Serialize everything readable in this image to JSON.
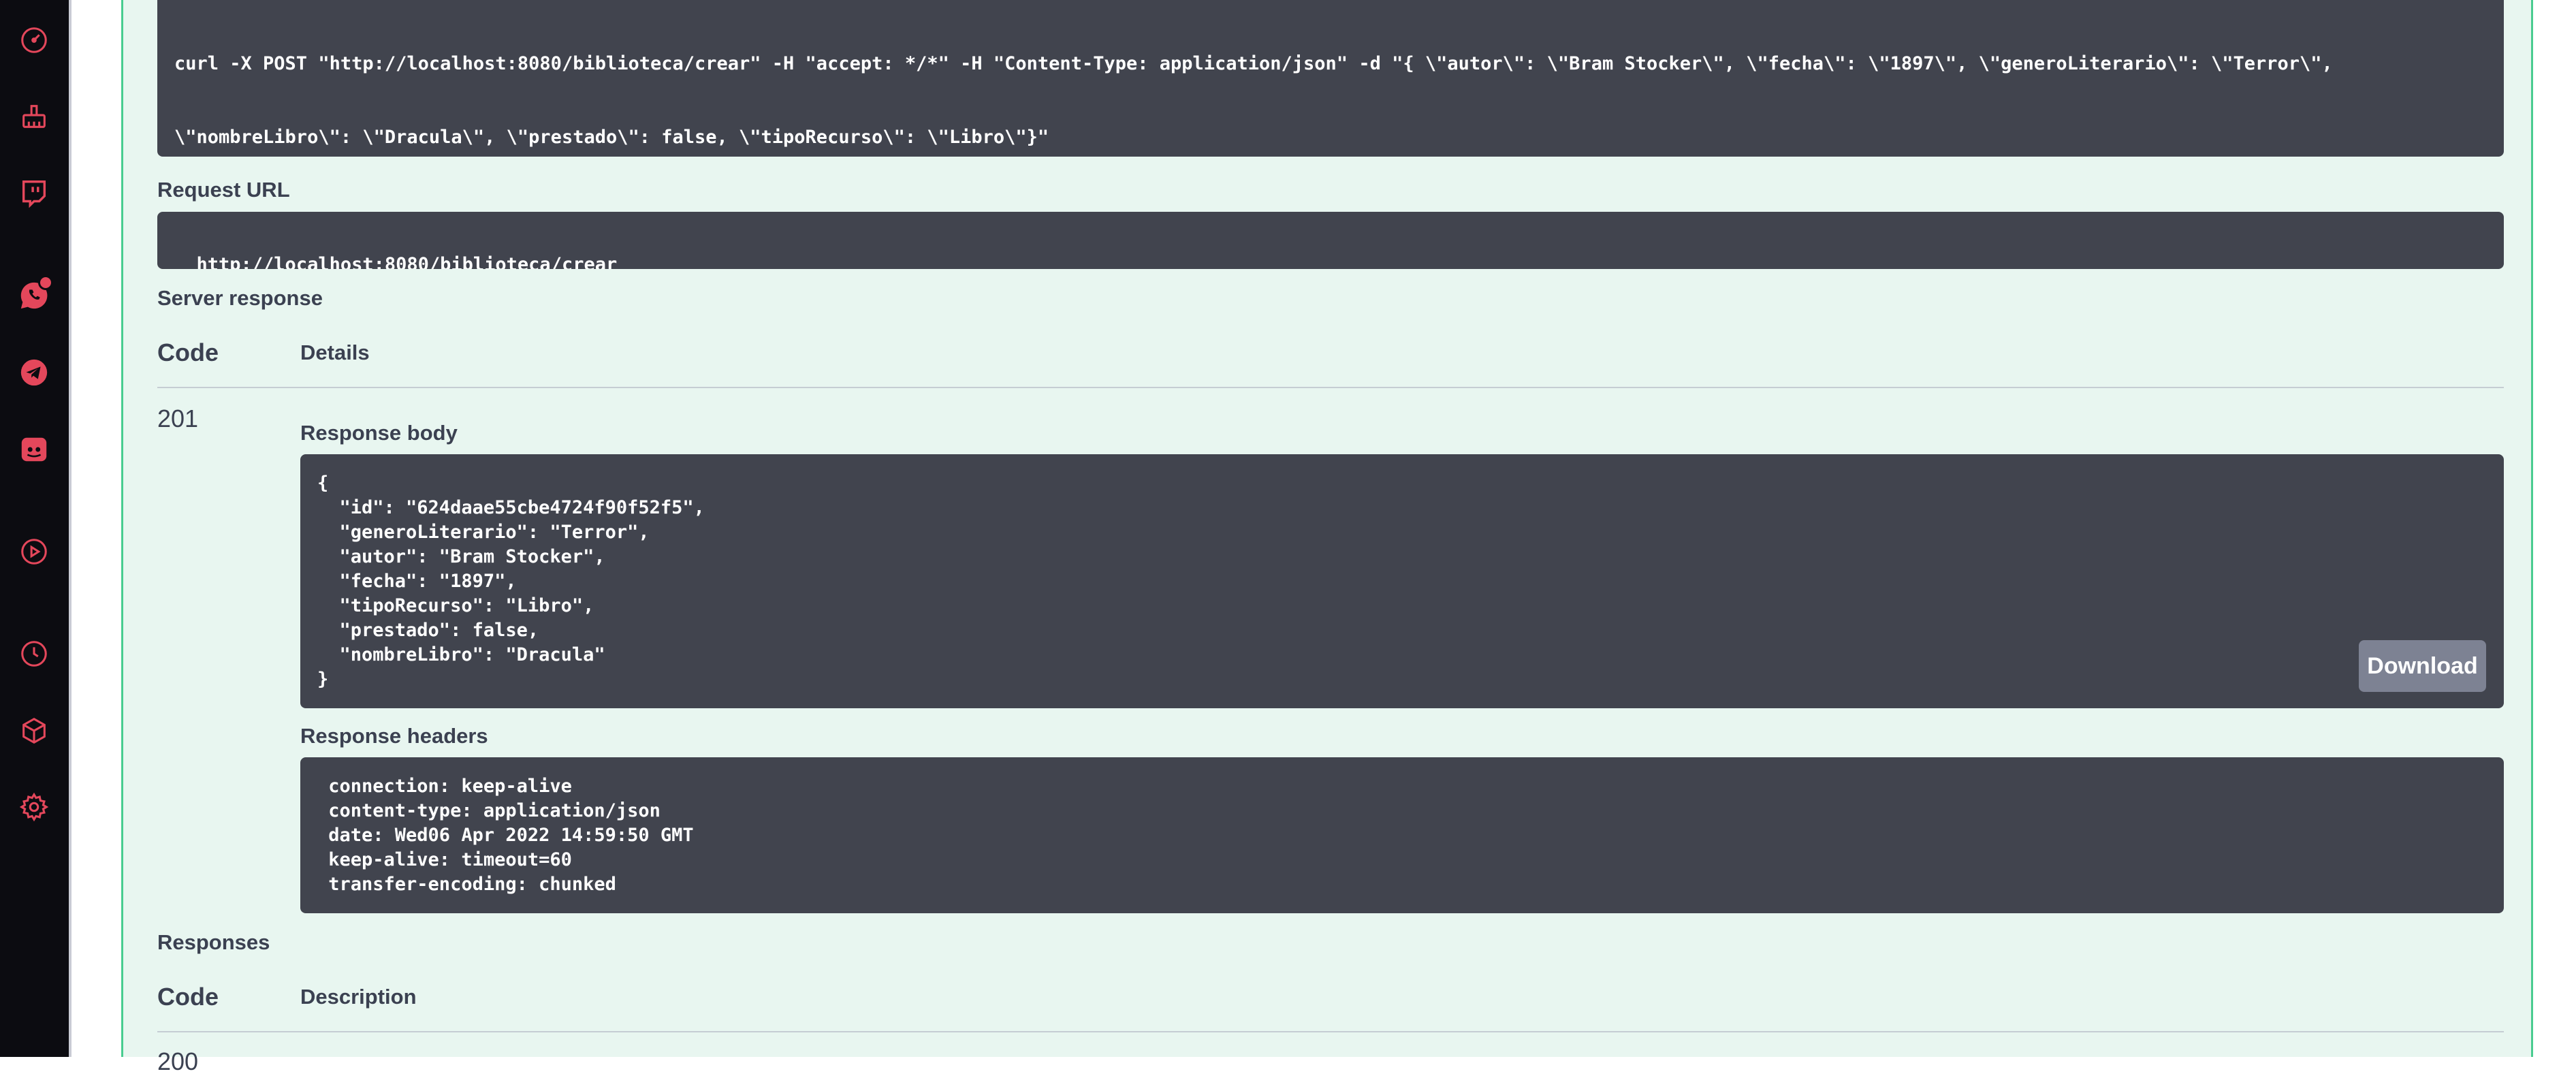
{
  "sidebar": {
    "icons": [
      {
        "name": "dashboard-gauge-icon"
      },
      {
        "name": "cleaning-brush-icon"
      },
      {
        "name": "twitch-icon"
      },
      {
        "name": "whatsapp-icon",
        "notification": true
      },
      {
        "name": "telegram-icon"
      },
      {
        "name": "discord-icon"
      },
      {
        "name": "play-circle-icon"
      },
      {
        "name": "history-clock-icon"
      },
      {
        "name": "cube-icon"
      },
      {
        "name": "settings-gear-icon"
      }
    ]
  },
  "curl": {
    "command_line1": "curl -X POST \"http://localhost:8080/biblioteca/crear\" -H \"accept: */*\" -H \"Content-Type: application/json\" -d \"{ \\\"autor\\\": \\\"Bram Stocker\\\", \\\"fecha\\\": \\\"1897\\\", \\\"generoLiterario\\\": \\\"Terror\\\",",
    "command_line2": "\\\"nombreLibro\\\": \\\"Dracula\\\", \\\"prestado\\\": false, \\\"tipoRecurso\\\": \\\"Libro\\\"}\""
  },
  "request_url": {
    "label": "Request URL",
    "value": "http://localhost:8080/biblioteca/crear"
  },
  "server_response": {
    "label": "Server response",
    "col_code": "Code",
    "col_details": "Details",
    "code": "201",
    "response_body_label": "Response body",
    "response_body_lines": [
      "{",
      "  \"id\": \"624daae55cbe4724f90f52f5\",",
      "  \"generoLiterario\": \"Terror\",",
      "  \"autor\": \"Bram Stocker\",",
      "  \"fecha\": \"1897\",",
      "  \"tipoRecurso\": \"Libro\",",
      "  \"prestado\": false,",
      "  \"nombreLibro\": \"Dracula\"",
      "}"
    ],
    "download_label": "Download",
    "response_headers_label": "Response headers",
    "response_headers_lines": [
      " connection: keep-alive",
      " content-type: application/json",
      " date: Wed06 Apr 2022 14:59:50 GMT",
      " keep-alive: timeout=60",
      " transfer-encoding: chunked"
    ]
  },
  "responses": {
    "label": "Responses",
    "col_code": "Code",
    "col_description": "Description",
    "first_code_partial": "200"
  }
}
